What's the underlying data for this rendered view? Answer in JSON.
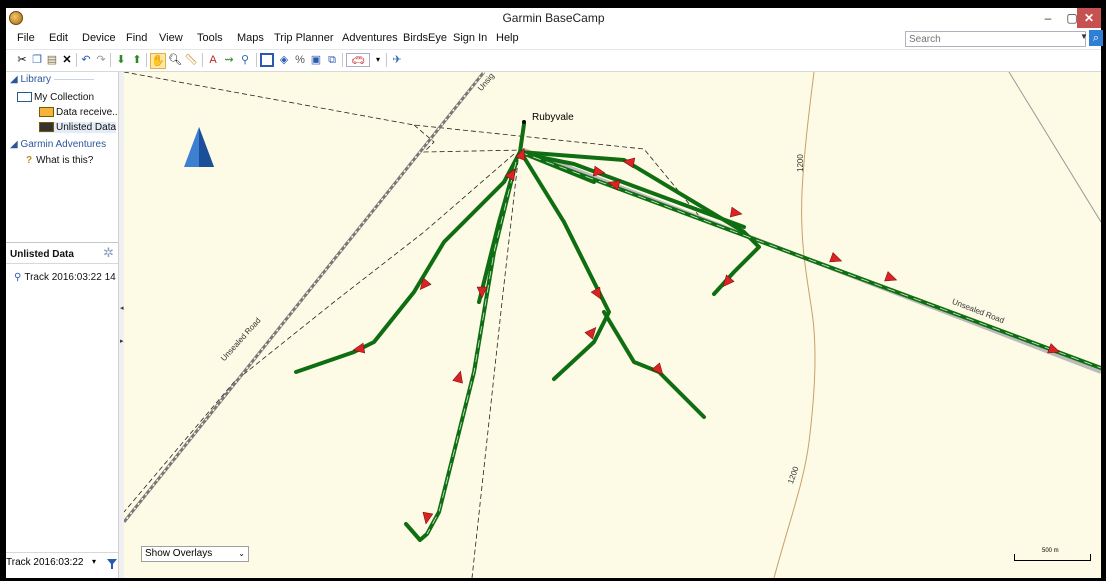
{
  "window": {
    "title": "Garmin BaseCamp"
  },
  "menu": [
    "File",
    "Edit",
    "Device",
    "Find",
    "View",
    "Tools",
    "Maps",
    "Trip Planner",
    "Adventures",
    "BirdsEye",
    "Sign In",
    "Help"
  ],
  "search": {
    "placeholder": "Search"
  },
  "library": {
    "header": "Library",
    "my_collection": "My Collection",
    "data_received": "Data receive..",
    "unlisted_data": "Unlisted Data",
    "adventures_header": "Garmin Adventures",
    "what_is_this": "What is this?"
  },
  "list_panel": {
    "title": "Unlisted Data",
    "items": [
      "Track 2016:03:22 14"
    ]
  },
  "bottom_combo": {
    "value": "Track 2016:03:22"
  },
  "map": {
    "place_label": "Rubyvale",
    "road_labels": [
      "Unsealed Road",
      "Unsealed Road",
      "Unsig"
    ],
    "contour_labels": [
      "1200",
      "1200"
    ],
    "overlays_select": "Show Overlays",
    "scale_label": "500 m"
  },
  "colors": {
    "map_bg": "#fdfbe5",
    "track": "#0f6e12",
    "arrow": "#d72424",
    "contour": "#c8a06a"
  },
  "icons": [
    "garmin-app-icon",
    "cut-icon",
    "copy-icon",
    "paste-icon",
    "delete-icon",
    "undo-icon",
    "redo-icon",
    "receive-icon",
    "send-icon",
    "hand-tool-icon",
    "zoom-icon",
    "measure-icon",
    "waypoint-icon",
    "route-icon",
    "track-icon",
    "map-2d-icon",
    "map-3d-icon",
    "north-arrow-icon",
    "gear-icon",
    "filter-icon"
  ]
}
